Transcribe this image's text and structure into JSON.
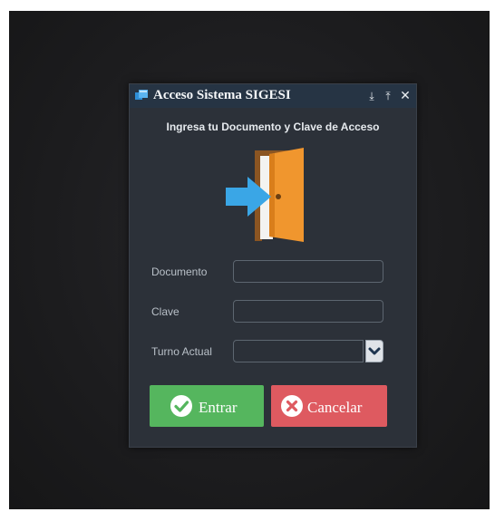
{
  "window": {
    "title": "Acceso Sistema SIGESI",
    "minimize_glyph": "⤓",
    "maximize_glyph": "⤒",
    "close_glyph": "✕",
    "app_icon": "window-app-icon"
  },
  "prompt": "Ingresa tu Documento y Clave de Acceso",
  "illustration": "door-enter-icon",
  "form": {
    "documento": {
      "label": "Documento",
      "value": ""
    },
    "clave": {
      "label": "Clave",
      "value": ""
    },
    "turno": {
      "label": "Turno Actual",
      "selected": "",
      "icon": "chevron-down-icon"
    }
  },
  "actions": {
    "enter": {
      "label": "Entrar",
      "icon": "check-circle-icon",
      "color": "#55b65e"
    },
    "cancel": {
      "label": "Cancelar",
      "icon": "x-circle-icon",
      "color": "#de5a60"
    }
  },
  "colors": {
    "dialog_bg": "#2c3139",
    "titlebar_bg": "#263444",
    "door_orange": "#f0962e",
    "arrow_blue": "#3aa6e6"
  }
}
